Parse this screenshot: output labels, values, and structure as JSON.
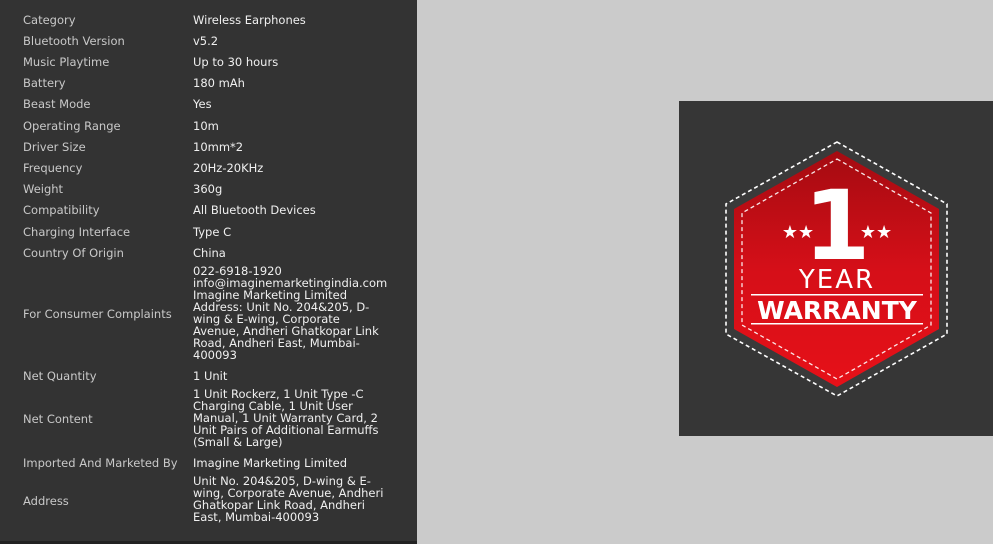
{
  "specs": [
    {
      "label": "Category",
      "value": "Wireless Earphones"
    },
    {
      "label": "Bluetooth Version",
      "value": "v5.2"
    },
    {
      "label": "Music Playtime",
      "value": "Up to 30 hours"
    },
    {
      "label": "Battery",
      "value": "180 mAh"
    },
    {
      "label": "Beast Mode",
      "value": "Yes"
    },
    {
      "label": "Operating Range",
      "value": "10m"
    },
    {
      "label": "Driver Size",
      "value": "10mm*2"
    },
    {
      "label": "Frequency",
      "value": "20Hz-20KHz"
    },
    {
      "label": "Weight",
      "value": "360g"
    },
    {
      "label": "Compatibility",
      "value": "All Bluetooth Devices"
    },
    {
      "label": "Charging Interface",
      "value": "Type C"
    },
    {
      "label": "Country Of Origin",
      "value": "China"
    },
    {
      "label": "For Consumer Complaints",
      "value": "022-6918-1920\ninfo@imaginemarketingindia.com\nImagine Marketing Limited\nAddress: Unit No. 204&205, D-\nwing & E-wing, Corporate\nAvenue, Andheri Ghatkopar Link\nRoad, Andheri East, Mumbai-\n400093"
    },
    {
      "label": "Net Quantity",
      "value": "1 Unit"
    },
    {
      "label": "Net Content",
      "value": "1 Unit Rockerz, 1 Unit Type -C\nCharging Cable, 1 Unit User\nManual, 1 Unit Warranty Card, 2\nUnit Pairs of Additional Earmuffs\n(Small & Large)"
    },
    {
      "label": "Imported And Marketed By",
      "value": "Imagine Marketing Limited"
    },
    {
      "label": "Address",
      "value": "Unit No. 204&205, D-wing & E-\nwing, Corporate Avenue, Andheri\nGhatkopar Link Road, Andheri\nEast, Mumbai-400093"
    }
  ],
  "badge": {
    "number": "1",
    "year": "YEAR",
    "warranty": "WARRANTY",
    "stars": "★★",
    "colors": {
      "red": "#e0101a",
      "dark_red": "#9e0a10",
      "card": "#363636"
    }
  }
}
